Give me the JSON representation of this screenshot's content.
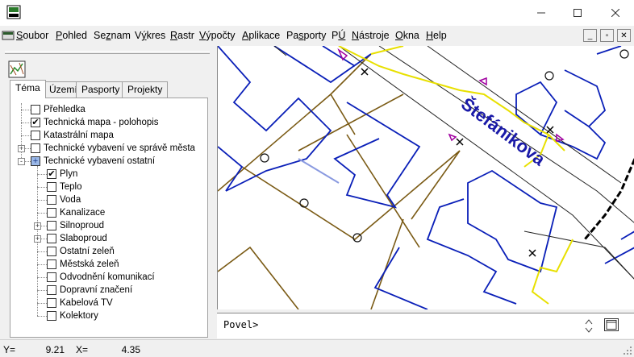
{
  "window": {
    "min_icon": "minimize-icon",
    "max_icon": "maximize-icon",
    "close_icon": "close-icon"
  },
  "menu": {
    "items": [
      {
        "pre": "",
        "ul": "S",
        "post": "oubor"
      },
      {
        "pre": "",
        "ul": "P",
        "post": "ohled"
      },
      {
        "pre": "Se",
        "ul": "z",
        "post": "nam"
      },
      {
        "pre": "V",
        "ul": "ý",
        "post": "kres"
      },
      {
        "pre": "",
        "ul": "R",
        "post": "astr"
      },
      {
        "pre": "",
        "ul": "V",
        "post": "ýpočty"
      },
      {
        "pre": "",
        "ul": "A",
        "post": "plikace"
      },
      {
        "pre": "Pa",
        "ul": "s",
        "post": "porty"
      },
      {
        "pre": "P",
        "ul": "Ú",
        "post": ""
      },
      {
        "pre": "",
        "ul": "N",
        "post": "ástroje"
      },
      {
        "pre": "",
        "ul": "O",
        "post": "kna"
      },
      {
        "pre": "",
        "ul": "H",
        "post": "elp"
      }
    ],
    "mdi_buttons": [
      "_",
      "▫",
      "✕"
    ]
  },
  "tabs": [
    "Téma",
    "Území",
    "Pasporty",
    "Projekty"
  ],
  "tree": [
    {
      "label": "Přehledka",
      "checked": false,
      "level": 0,
      "expander": ""
    },
    {
      "label": "Technická mapa - polohopis",
      "checked": true,
      "level": 0,
      "expander": ""
    },
    {
      "label": "Katastrální mapa",
      "checked": false,
      "level": 0,
      "expander": ""
    },
    {
      "label": "Technické vybavení ve správě města",
      "checked": false,
      "level": 0,
      "expander": "+"
    },
    {
      "label": "Technické vybavení ostatní",
      "checked": "partial",
      "level": 0,
      "expander": "-"
    },
    {
      "label": "Plyn",
      "checked": true,
      "level": 1,
      "expander": ""
    },
    {
      "label": "Teplo",
      "checked": false,
      "level": 1,
      "expander": ""
    },
    {
      "label": "Voda",
      "checked": false,
      "level": 1,
      "expander": ""
    },
    {
      "label": "Kanalizace",
      "checked": false,
      "level": 1,
      "expander": ""
    },
    {
      "label": "Silnoproud",
      "checked": false,
      "level": 1,
      "expander": "+"
    },
    {
      "label": "Slaboproud",
      "checked": false,
      "level": 1,
      "expander": "+"
    },
    {
      "label": "Ostatní zeleň",
      "checked": false,
      "level": 1,
      "expander": ""
    },
    {
      "label": "Městská zeleň",
      "checked": false,
      "level": 1,
      "expander": ""
    },
    {
      "label": "Odvodnění komunikací",
      "checked": false,
      "level": 1,
      "expander": ""
    },
    {
      "label": "Dopravní značení",
      "checked": false,
      "level": 1,
      "expander": ""
    },
    {
      "label": "Kabelová TV",
      "checked": false,
      "level": 1,
      "expander": ""
    },
    {
      "label": "Kolektory",
      "checked": false,
      "level": 1,
      "expander": ""
    }
  ],
  "map": {
    "street_label": "Štefánikova",
    "street_color": "#1a1aa8",
    "building_color": "#0a1fb8",
    "parcel_color": "#7a5a14",
    "gas_color": "#e8e000"
  },
  "command": {
    "prompt": "Povel>"
  },
  "status": {
    "y_label": "Y=",
    "y_value": "9.21",
    "x_label": "X=",
    "x_value": "4.35"
  }
}
